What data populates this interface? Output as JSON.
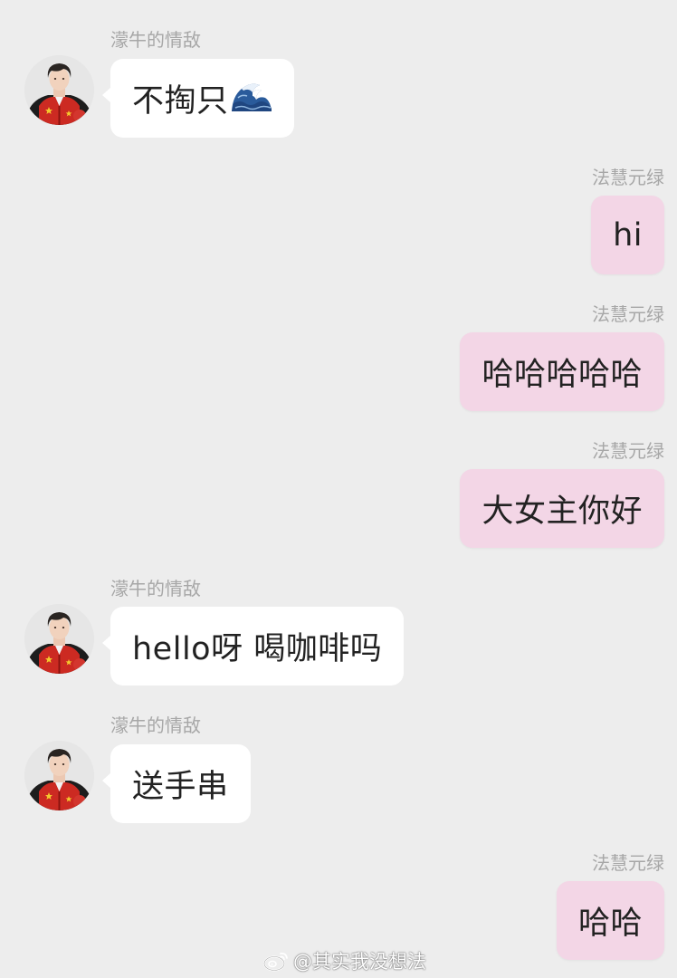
{
  "contacts": {
    "other": "濛牛的情敌",
    "self": "法慧元绿"
  },
  "messages": [
    {
      "sender": "濛牛的情敌",
      "text": "不掏只",
      "emoji": "water-wave-icon"
    },
    {
      "sender": "法慧元绿",
      "text": "hi"
    },
    {
      "sender": "法慧元绿",
      "text": "哈哈哈哈哈"
    },
    {
      "sender": "法慧元绿",
      "text": "大女主你好"
    },
    {
      "sender": "濛牛的情敌",
      "text": "hello呀 喝咖啡吗"
    },
    {
      "sender": "濛牛的情敌",
      "text": "送手串"
    },
    {
      "sender": "法慧元绿",
      "text": "哈哈"
    }
  ],
  "watermark": {
    "icon": "weibo-logo",
    "text": "@其实我没想法"
  },
  "colors": {
    "background": "#ededed",
    "incoming_bubble": "#ffffff",
    "outgoing_bubble": "#f3d6e6",
    "name_text": "#a7a7a7",
    "message_text": "#222222"
  }
}
